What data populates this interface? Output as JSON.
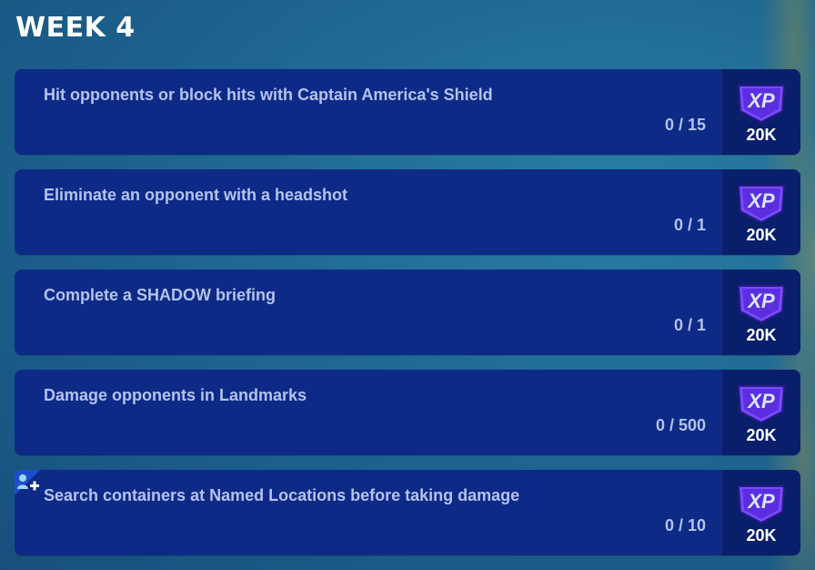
{
  "header": {
    "title": "WEEK 4"
  },
  "quests": [
    {
      "name": "Hit opponents or block hits with Captain America's Shield",
      "progress": "0 / 15",
      "xp_badge": "XP",
      "xp_amount": "20K"
    },
    {
      "name": "Eliminate an opponent with a headshot",
      "progress": "0 / 1",
      "xp_badge": "XP",
      "xp_amount": "20K"
    },
    {
      "name": "Complete a SHADOW briefing",
      "progress": "0 / 1",
      "xp_badge": "XP",
      "xp_amount": "20K"
    },
    {
      "name": "Damage opponents in Landmarks",
      "progress": "0 / 500",
      "xp_badge": "XP",
      "xp_amount": "20K"
    },
    {
      "name": "Search containers at Named Locations before taking damage",
      "progress": "0 / 10",
      "xp_badge": "XP",
      "xp_amount": "20K",
      "party_icon": "party-assist-icon"
    }
  ],
  "colors": {
    "card_bg": "#0d2a87",
    "reward_bg": "#0a1f6b",
    "text": "#b4c3ee",
    "xp_purple": "#6a3df0"
  }
}
